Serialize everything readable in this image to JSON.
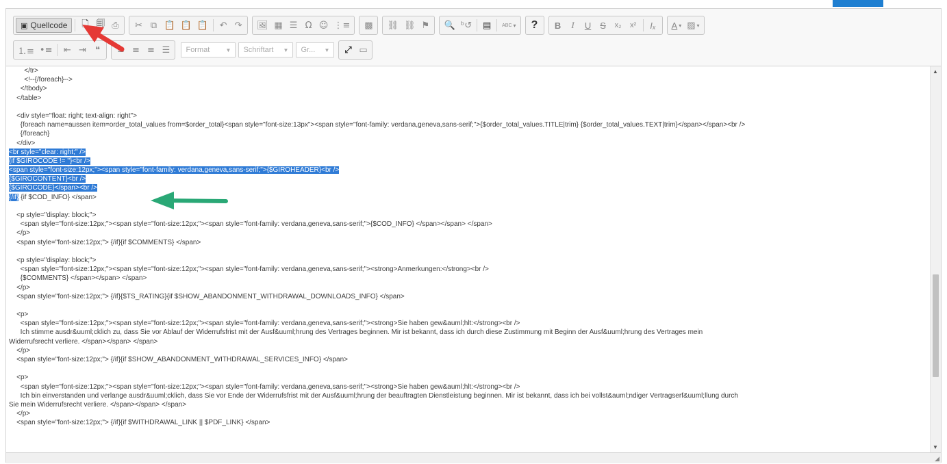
{
  "toolbar": {
    "source_label": "Quellcode",
    "format_label": "Format",
    "font_label": "Schriftart",
    "size_label": "Gr...",
    "help_label": "?",
    "bold_label": "B",
    "italic_label": "I",
    "underline_label": "U",
    "strike_label": "S",
    "sub_label": "x₂",
    "sup_label": "x²",
    "removeformat_label": "Iₓ",
    "textcolor_label": "A",
    "spellcheck_label": "ABC"
  },
  "icons": {
    "new_page": "new-page-icon",
    "preview": "preview-icon",
    "print": "print-icon",
    "cut": "cut-icon",
    "copy": "copy-icon",
    "paste": "paste-icon",
    "paste_text": "paste-text-icon",
    "paste_word": "paste-word-icon",
    "undo": "undo-icon",
    "redo": "redo-icon",
    "image": "image-icon",
    "table": "table-icon",
    "hline": "horizontal-line-icon",
    "special_char": "special-char-icon",
    "smiley": "smiley-icon",
    "maximize": "maximize-icon"
  },
  "colors": {
    "selection": "#2f7bd6",
    "top_accent": "#1f7fd1",
    "annotation_arrow_red": "#e53935",
    "annotation_arrow_green": "#2aa876"
  },
  "code_lines": [
    {
      "text": "        </tr>",
      "hl": ""
    },
    {
      "text": "        <!--{/foreach}-->",
      "hl": ""
    },
    {
      "text": "      </tbody>",
      "hl": ""
    },
    {
      "text": "    </table>",
      "hl": ""
    },
    {
      "text": "",
      "hl": ""
    },
    {
      "text": "    <div style=\"float: right; text-align: right\">",
      "hl": ""
    },
    {
      "text": "      {foreach name=aussen item=order_total_values from=$order_total}<span style=\"font-size:13px\"><span style=\"font-family: verdana,geneva,sans-serif;\">{$order_total_values.TITLE|trim} {$order_total_values.TEXT|trim}</span></span><br />",
      "hl": ""
    },
    {
      "text": "      {/foreach}",
      "hl": ""
    },
    {
      "text": "    </div>",
      "hl": ""
    },
    {
      "text": "",
      "hl": "<br style=\"clear: right;\" />"
    },
    {
      "text": "",
      "hl": "{if $GIROCODE != ''}<br />"
    },
    {
      "text": "",
      "hl": "<span style=\"font-size:12px;\"><span style=\"font-family: verdana,geneva,sans-serif;\">{$GIROHEADER}<br />"
    },
    {
      "text": "",
      "hl": "{$GIROCONTENT}<br />"
    },
    {
      "text": "",
      "hl": "{$GIROCODE}</span><br />"
    },
    {
      "text": " {if $COD_INFO} </span>",
      "hl": "{/if}"
    },
    {
      "text": "",
      "hl": ""
    },
    {
      "text": "    <p style=\"display: block;\">",
      "hl": ""
    },
    {
      "text": "      <span style=\"font-size:12px;\"><span style=\"font-size:12px;\"><span style=\"font-family: verdana,geneva,sans-serif;\">{$COD_INFO} </span></span> </span>",
      "hl": ""
    },
    {
      "text": "    </p>",
      "hl": ""
    },
    {
      "text": "    <span style=\"font-size:12px;\"> {/if}{if $COMMENTS} </span>",
      "hl": ""
    },
    {
      "text": "",
      "hl": ""
    },
    {
      "text": "    <p style=\"display: block;\">",
      "hl": ""
    },
    {
      "text": "      <span style=\"font-size:12px;\"><span style=\"font-size:12px;\"><span style=\"font-family: verdana,geneva,sans-serif;\"><strong>Anmerkungen:</strong><br />",
      "hl": ""
    },
    {
      "text": "      {$COMMENTS} </span></span> </span>",
      "hl": ""
    },
    {
      "text": "    </p>",
      "hl": ""
    },
    {
      "text": "    <span style=\"font-size:12px;\"> {/if}{$TS_RATING}{if $SHOW_ABANDONMENT_WITHDRAWAL_DOWNLOADS_INFO} </span>",
      "hl": ""
    },
    {
      "text": "",
      "hl": ""
    },
    {
      "text": "    <p>",
      "hl": ""
    },
    {
      "text": "      <span style=\"font-size:12px;\"><span style=\"font-size:12px;\"><span style=\"font-family: verdana,geneva,sans-serif;\"><strong>Sie haben gew&auml;hlt:</strong><br />",
      "hl": ""
    },
    {
      "text": "      Ich stimme ausdr&uuml;cklich zu, dass Sie vor Ablauf der Widerrufsfrist mit der Ausf&uuml;hrung des Vertrages beginnen. Mir ist bekannt, dass ich durch diese Zustimmung mit Beginn der Ausf&uuml;hrung des Vertrages mein",
      "hl": ""
    },
    {
      "text": "Widerrufsrecht verliere. </span></span> </span>",
      "hl": ""
    },
    {
      "text": "    </p>",
      "hl": ""
    },
    {
      "text": "    <span style=\"font-size:12px;\"> {/if}{if $SHOW_ABANDONMENT_WITHDRAWAL_SERVICES_INFO} </span>",
      "hl": ""
    },
    {
      "text": "",
      "hl": ""
    },
    {
      "text": "    <p>",
      "hl": ""
    },
    {
      "text": "      <span style=\"font-size:12px;\"><span style=\"font-size:12px;\"><span style=\"font-family: verdana,geneva,sans-serif;\"><strong>Sie haben gew&auml;hlt:</strong><br />",
      "hl": ""
    },
    {
      "text": "      Ich bin einverstanden und verlange ausdr&uuml;cklich, dass Sie vor Ende der Widerrufsfrist mit der Ausf&uuml;hrung der beauftragten Dienstleistung beginnen. Mir ist bekannt, dass ich bei vollst&auml;ndiger Vertragserf&uuml;llung durch",
      "hl": ""
    },
    {
      "text": "Sie mein Widerrufsrecht verliere. </span></span> </span>",
      "hl": ""
    },
    {
      "text": "    </p>",
      "hl": ""
    },
    {
      "text": "    <span style=\"font-size:12px;\"> {/if}{if $WITHDRAWAL_LINK || $PDF_LINK} </span>",
      "hl": ""
    }
  ]
}
